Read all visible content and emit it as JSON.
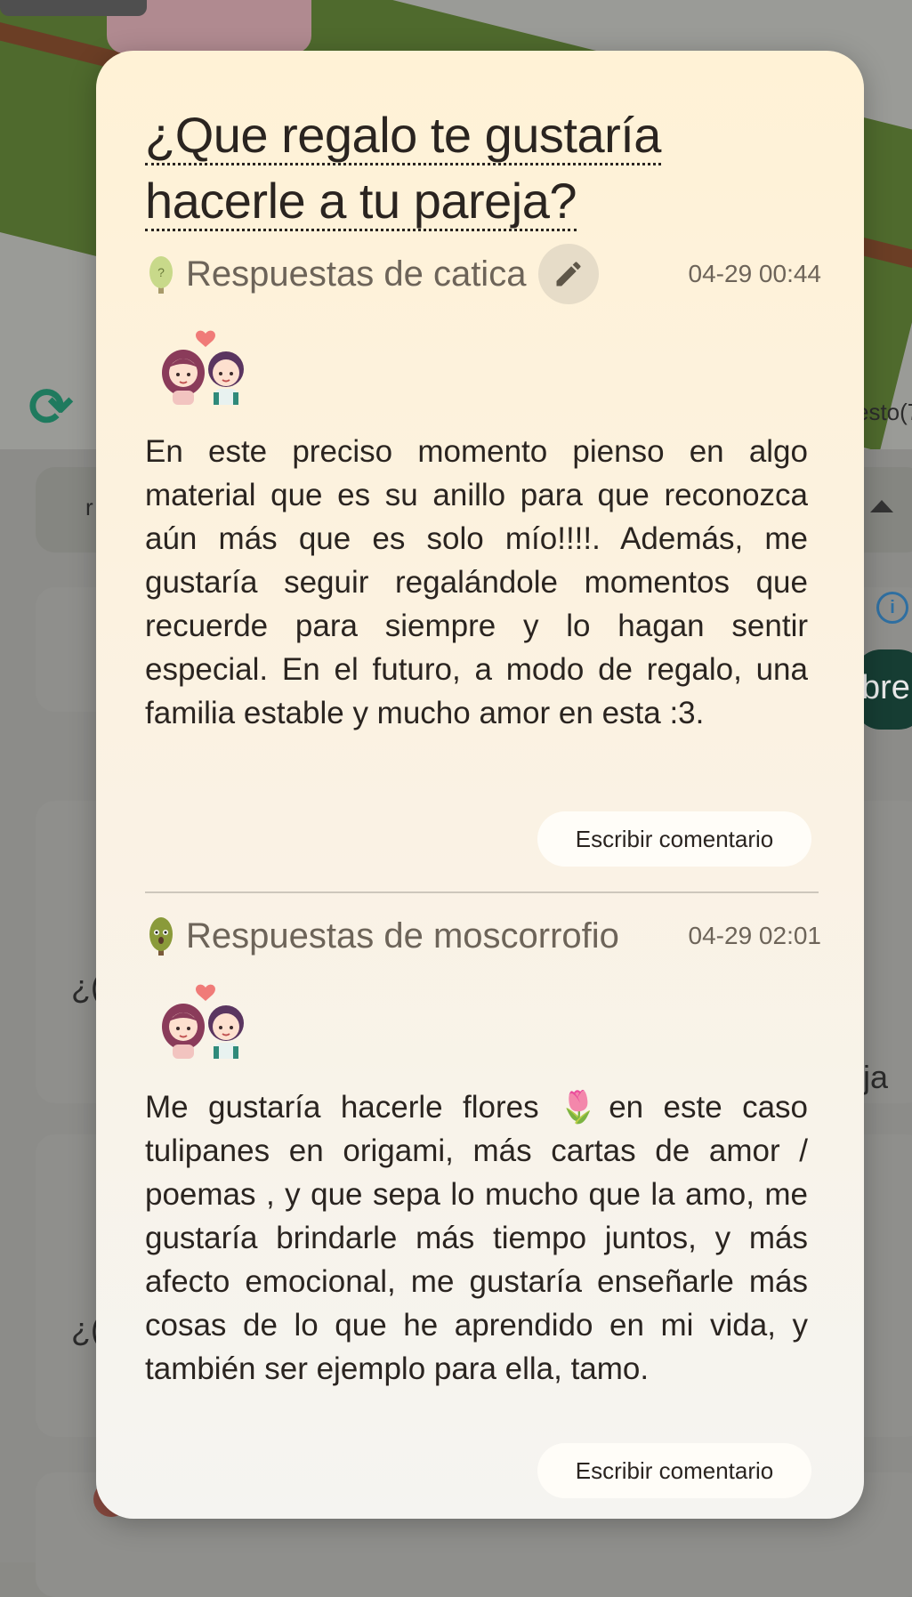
{
  "question": {
    "title": "¿Que regalo te gustaría hacerle a tu pareja?"
  },
  "answers": [
    {
      "author": "Respuestas de catica",
      "date": "04-29 00:44",
      "text": "En este preciso momento pienso en algo material que es su anillo para que reconozca aún más que es solo mío!!!!. Además, me gustaría seguir regalándole momentos que recuerde para siempre y lo hagan sentir especial. En el futuro, a modo de regalo, una familia estable y mucho amor en esta :3.",
      "comment_label": "Escribir comentario",
      "editable": true,
      "tree_icon": "light-green-sapling-icon"
    },
    {
      "author": "Respuestas de moscorrofio",
      "date": "04-29 02:01",
      "text": "Me gustaría hacerle flores 🌷en este caso tulipanes en origami, más cartas de amor / poemas , y que sepa lo mucho que la amo, me gustaría brindarle más tiempo juntos, y más afecto emocional, me gustaría enseñarle más cosas de lo que he aprendido en mi vida, y también ser ejemplo para ella, tamo.",
      "comment_label": "Escribir comentario",
      "editable": false,
      "tree_icon": "olive-tree-face-icon"
    }
  ],
  "background": {
    "partial_label_right": "esto(7",
    "partial_button_text": "bre",
    "partial_text_left_1": "¿(",
    "partial_text_left_2": "¿(",
    "partial_text_right": "ja",
    "partial_chip_text": "r"
  },
  "colors": {
    "modal_top": "#fff2d6",
    "modal_bottom": "#f5f4f1",
    "text": "#2a2420",
    "muted": "#6d6459",
    "accent_green": "#1f7a5e"
  }
}
